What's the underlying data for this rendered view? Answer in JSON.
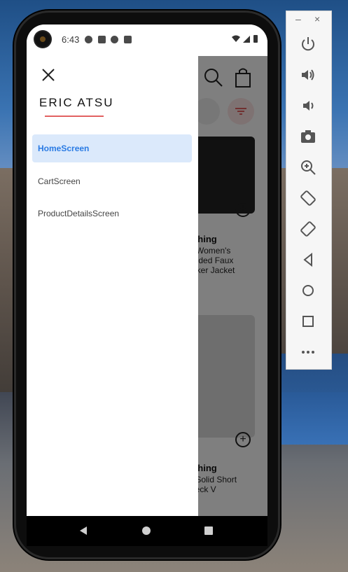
{
  "status_bar": {
    "time": "6:43"
  },
  "drawer": {
    "user_name": "ERIC ATSU",
    "nav_items": [
      {
        "label": "HomeScreen",
        "active": true
      },
      {
        "label": "CartScreen",
        "active": false
      },
      {
        "label": "ProductDetailsScreen",
        "active": false
      }
    ]
  },
  "background_app": {
    "products": [
      {
        "category": "othing",
        "title_lines": [
          "e Women's",
          "ooded Faux",
          "Biker Jacket"
        ]
      },
      {
        "category": "othing",
        "title_lines": [
          "s Solid Short",
          "Neck V"
        ]
      }
    ]
  },
  "emulator_panel": {
    "buttons": [
      "power",
      "volume-up",
      "volume-down",
      "camera",
      "zoom",
      "rotate-left",
      "rotate-right",
      "back",
      "home",
      "overview",
      "more"
    ]
  },
  "colors": {
    "accent": "#2a7be4",
    "active_bg": "#dbe9fb",
    "underline": "#e26161",
    "scrim": "rgba(0,0,0,0.5)"
  }
}
